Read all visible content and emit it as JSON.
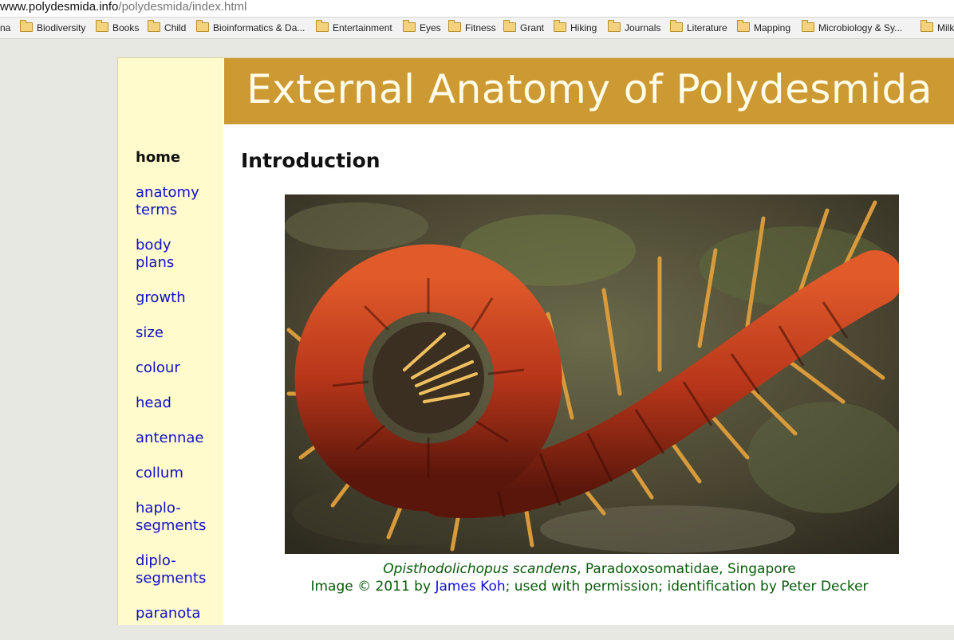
{
  "browser": {
    "url_host": "www.polydesmida.info",
    "url_path": "/polydesmida/index.html",
    "bookmarks": [
      "na",
      "Biodiversity",
      "Books",
      "Child",
      "Bioinformatics & Da...",
      "Entertainment",
      "Eyes",
      "Fitness",
      "Grant",
      "Hiking",
      "Journals",
      "Literature",
      "Mapping",
      "Microbiology & Sy...",
      "Milk"
    ]
  },
  "page": {
    "banner_title": "External Anatomy of Polydesmida",
    "heading": "Introduction",
    "nav": [
      {
        "label": "home",
        "current": true
      },
      {
        "label": "anatomy terms"
      },
      {
        "label": "body plans"
      },
      {
        "label": "growth"
      },
      {
        "label": "size"
      },
      {
        "label": "colour"
      },
      {
        "label": "head"
      },
      {
        "label": "antennae"
      },
      {
        "label": "collum"
      },
      {
        "label": "haplo-segments"
      },
      {
        "label": "diplo-segments"
      },
      {
        "label": "paranota"
      }
    ],
    "caption": {
      "species": "Opisthodolichopus scandens",
      "rest_line1": ", Paradoxosomatidae, Singapore",
      "image_credit_prefix": "Image © 2011 by ",
      "photographer": "James Koh",
      "credit_suffix": "; used with permission; identification by Peter Decker"
    }
  },
  "colors": {
    "banner": "#cc9933",
    "sidebar": "#fffbcc",
    "link": "#1010c8",
    "caption": "#0a5a0a"
  }
}
